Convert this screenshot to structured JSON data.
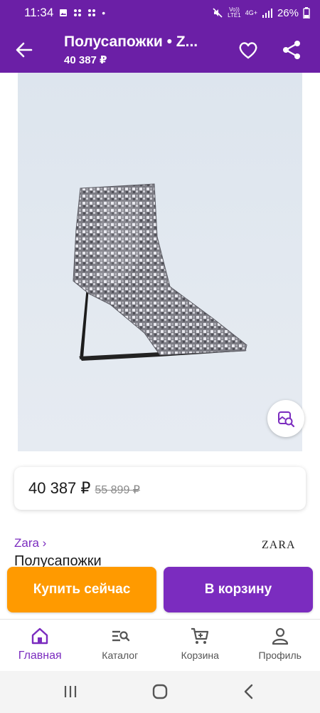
{
  "status_bar": {
    "time": "11:34",
    "network_top": "Vo))",
    "network_bottom": "LTE1",
    "signal_type": "4G+",
    "battery": "26%"
  },
  "app_bar": {
    "title": "Полусапожки • Z...",
    "subtitle": "40 387 ₽"
  },
  "product": {
    "price_current": "40 387 ₽",
    "price_old": "55 899 ₽",
    "brand_link": "Zara ›",
    "brand_logo": "ZARA",
    "name": "Полусапожки"
  },
  "actions": {
    "buy_now": "Купить сейчас",
    "add_to_cart": "В корзину"
  },
  "bottom_nav": {
    "items": [
      {
        "label": "Главная",
        "icon": "home-icon",
        "active": true
      },
      {
        "label": "Каталог",
        "icon": "catalog-search-icon",
        "active": false
      },
      {
        "label": "Корзина",
        "icon": "cart-icon",
        "active": false
      },
      {
        "label": "Профиль",
        "icon": "profile-icon",
        "active": false
      }
    ]
  },
  "colors": {
    "brand_purple": "#6b1fa6",
    "accent_purple": "#7b2cbf",
    "orange": "#ff9a00"
  }
}
